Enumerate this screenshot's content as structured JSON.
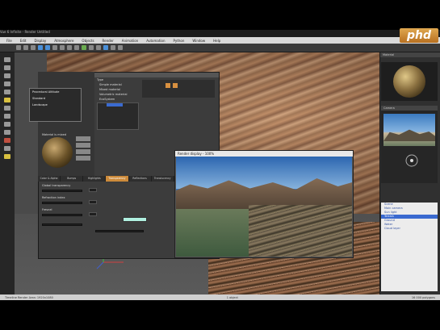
{
  "app": {
    "title": "Vue 6 Infinite - Render Untitled",
    "menu": [
      "File",
      "Edit",
      "Display",
      "Atmosphere",
      "Objects",
      "Render",
      "Animation",
      "Automation",
      "Python",
      "Window",
      "Help"
    ]
  },
  "logo": {
    "text": "phd"
  },
  "material_editor": {
    "title": "Advanced Material Editor - Terrain",
    "popup_items": [
      "Procedural Altitude",
      "Standard",
      "Landscape"
    ],
    "options": [
      "Material is mixed",
      "Type",
      "Simple material",
      "Mixed material",
      "Volumetric material",
      "EcoSystem"
    ],
    "tabs": [
      "Color & Alpha",
      "Bumps",
      "Highlights",
      "Transparency",
      "Reflections",
      "Translucency",
      "Effects",
      "Environment"
    ],
    "active_tab": "Transparency",
    "fields": [
      "Global transparency",
      "Refraction index",
      "Fresnel"
    ]
  },
  "render_window": {
    "title": "Render display - 100%"
  },
  "right_panel": {
    "sphere_header": "Material",
    "nav_header": "Camera",
    "tree": [
      "Scene",
      "Main camera",
      "Sun light",
      "Terrain",
      "Ground",
      "Water",
      "Cloud layer"
    ],
    "tree_selected_index": 3
  },
  "statusbar": {
    "left": "Timeline Render Area: 1920x1080",
    "mid": "1 object",
    "right": "16 000 polygons"
  }
}
